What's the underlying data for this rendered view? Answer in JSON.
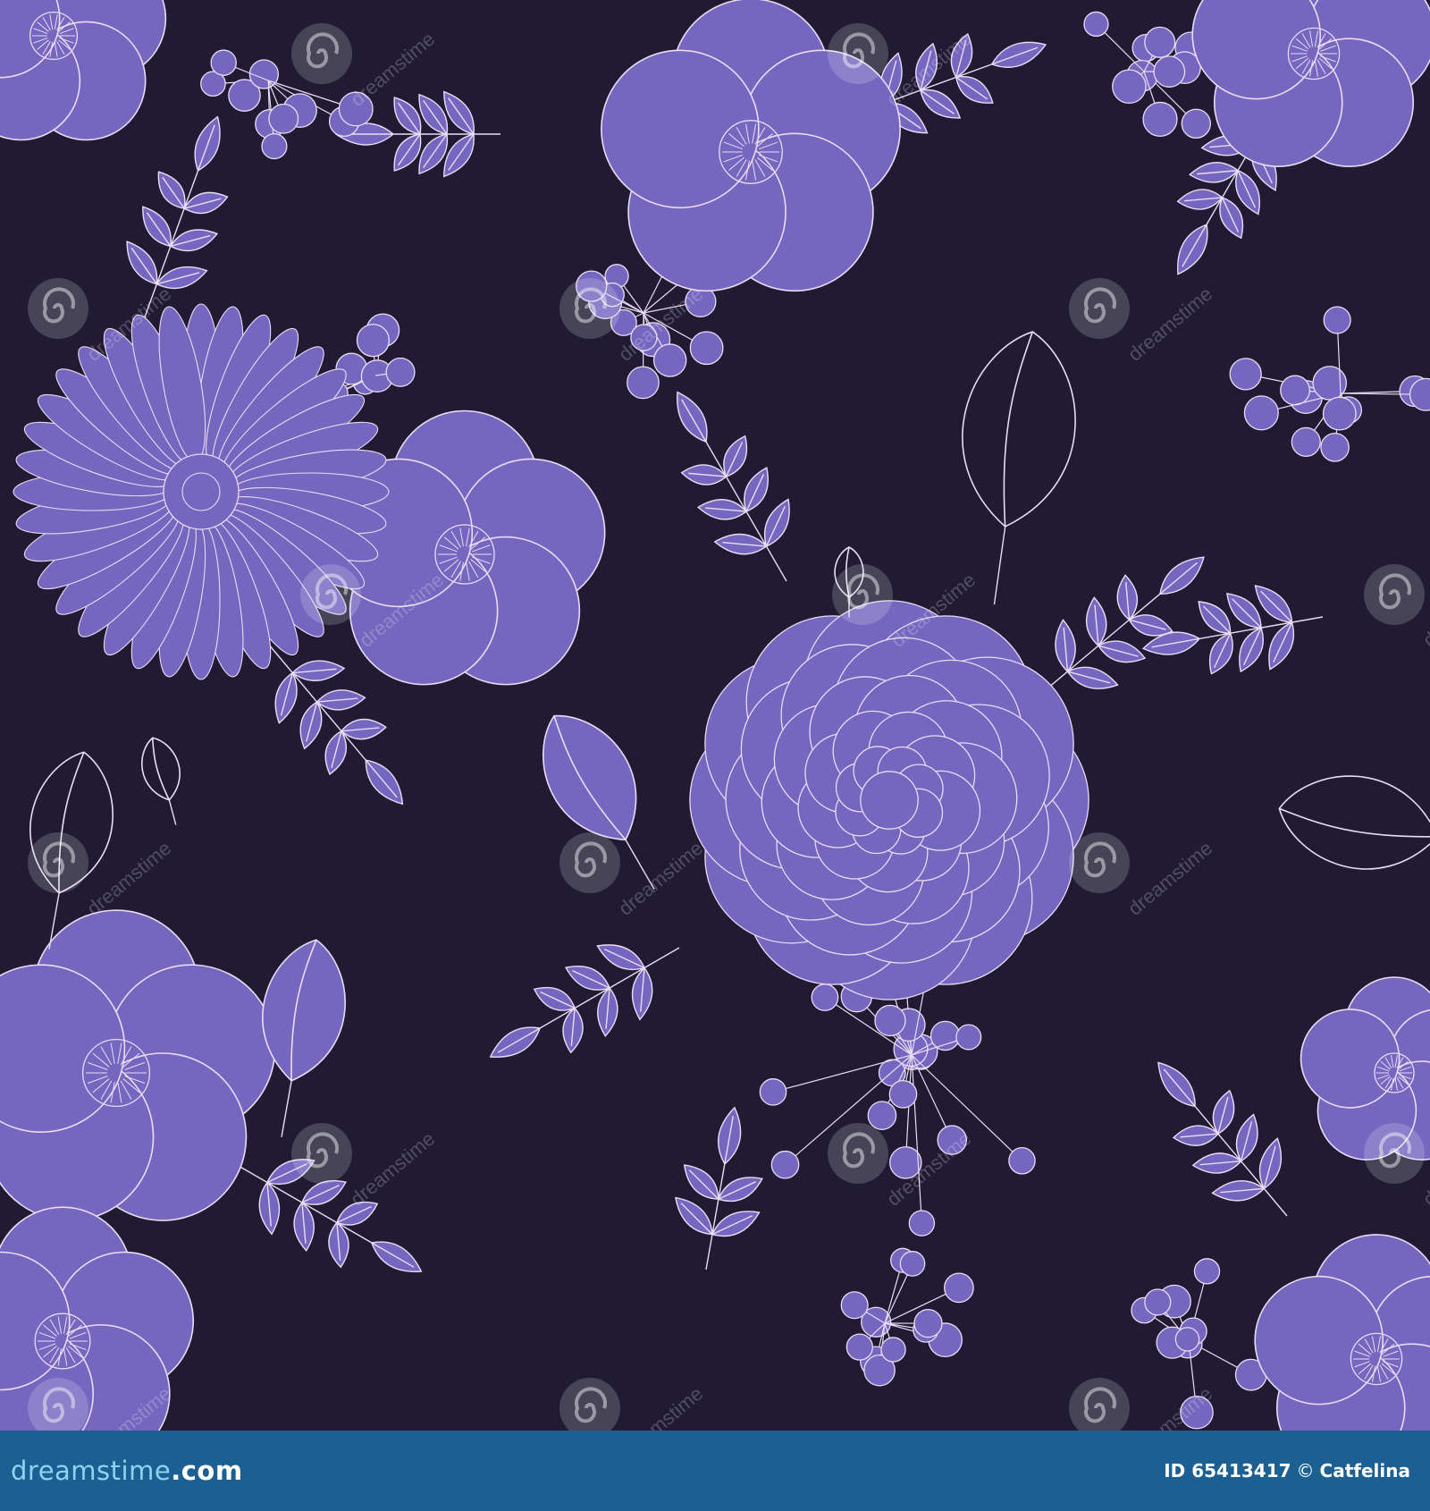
{
  "colors": {
    "background": "#201b32",
    "petal": "#7566c0",
    "outline": "#e9dcf3",
    "footer_background": "#1b5f93",
    "footer_accent": "#8ed3f2"
  },
  "image": {
    "subject": "seamless floral pattern",
    "motifs": [
      "peony",
      "wild-rose",
      "gerbera-daisy",
      "magnolia-bud",
      "sweet-pea",
      "berry-cluster",
      "leaf-sprig"
    ]
  },
  "watermark": {
    "text": "dreamstime",
    "icon": "swirl-icon"
  },
  "footer": {
    "logo_prefix": "dreamstime",
    "logo_suffix": ".com",
    "id_label": "ID 65413417",
    "copyright_symbol": "©",
    "author": "Catfelina"
  }
}
